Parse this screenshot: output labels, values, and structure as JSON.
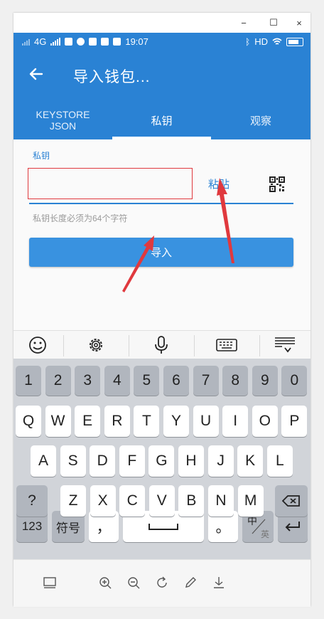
{
  "window": {
    "minimize": "−",
    "maximize": "☐",
    "close": "×"
  },
  "status_bar": {
    "network": "4G",
    "time": "19:07",
    "hd": "HD"
  },
  "app_bar": {
    "title": "导入钱包..."
  },
  "tabs": [
    {
      "label": "KEYSTORE\nJSON",
      "active": false
    },
    {
      "label": "私钥",
      "active": true
    },
    {
      "label": "观察",
      "active": false
    }
  ],
  "form": {
    "field_label": "私钥",
    "field_value": "",
    "paste_label": "粘贴",
    "hint": "私钥长度必须为64个字符",
    "import_label": "导入"
  },
  "keyboard": {
    "row_numbers": [
      "1",
      "2",
      "3",
      "4",
      "5",
      "6",
      "7",
      "8",
      "9",
      "0"
    ],
    "row_q": [
      "Q",
      "W",
      "E",
      "R",
      "T",
      "Y",
      "U",
      "I",
      "O",
      "P"
    ],
    "row_a": [
      "A",
      "S",
      "D",
      "F",
      "G",
      "H",
      "J",
      "K",
      "L"
    ],
    "row_z": [
      "Z",
      "X",
      "C",
      "V",
      "B",
      "N",
      "M"
    ],
    "question": "?",
    "num_key": "123",
    "symbol_key": "符号",
    "comma": "，",
    "period": "。",
    "lang_main": "中",
    "lang_sub": "英"
  },
  "colors": {
    "primary": "#2a82d4",
    "button": "#3992e0",
    "annotation": "#e0393e"
  }
}
